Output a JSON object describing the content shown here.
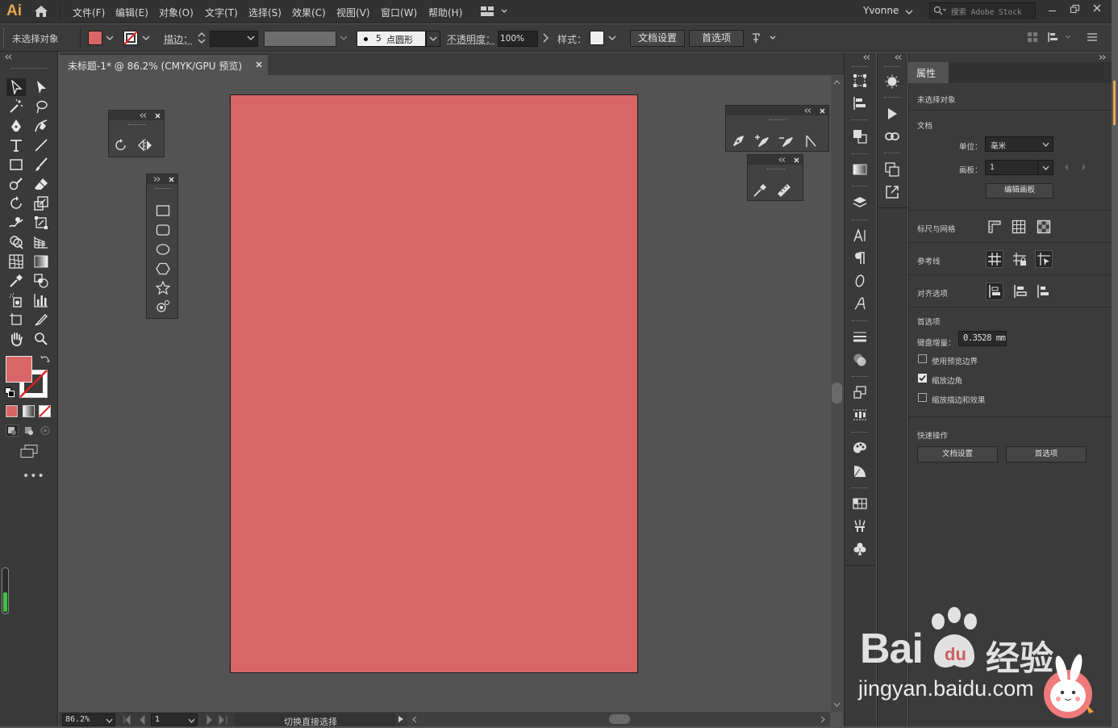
{
  "menubar": {
    "logo": "Ai",
    "items": [
      "文件(F)",
      "编辑(E)",
      "对象(O)",
      "文字(T)",
      "选择(S)",
      "效果(C)",
      "视图(V)",
      "窗口(W)",
      "帮助(H)"
    ],
    "user": "Yvonne",
    "search_placeholder": "搜索 Adobe Stock"
  },
  "controlbar": {
    "selection_status": "未选择对象",
    "stroke_label": "描边：",
    "brush_value": "5",
    "brush_label": "点圆形",
    "opacity_label": "不透明度：",
    "opacity_value": "100%",
    "style_label": "样式：",
    "doc_setup_button": "文档设置",
    "prefs_button": "首选项"
  },
  "document": {
    "tab_title": "未标题-1* @ 86.2% (CMYK/GPU 预览)",
    "artboard_color": "#d96666"
  },
  "status": {
    "zoom": "86.2%",
    "artboard_index": "1",
    "message": "切换直接选择"
  },
  "properties": {
    "tab": "属性",
    "no_selection": "未选择对象",
    "document_section": "文档",
    "units_label": "单位：",
    "units_value": "毫米",
    "artboard_label": "画板：",
    "artboard_value": "1",
    "edit_artboards_button": "编辑画板",
    "rulers_grids_label": "标尺与网格",
    "guides_label": "参考线",
    "align_options_label": "对齐选项",
    "preferences_section": "首选项",
    "keyboard_increment_label": "键盘增量：",
    "keyboard_increment_value": "0.3528 mm",
    "use_preview_bounds": "使用预览边界",
    "use_preview_bounds_checked": false,
    "scale_corners": "缩放边角",
    "scale_corners_checked": true,
    "scale_strokes_effects": "缩放描边和效果",
    "scale_strokes_effects_checked": false,
    "quick_actions_section": "快速操作",
    "doc_setup_button": "文档设置",
    "prefs_button": "首选项"
  },
  "watermark": {
    "brand": "Bai",
    "brand_cn": "经验",
    "url": "jingyan.baidu.com"
  },
  "colors": {
    "fill": "#d96666",
    "accent": "#e8a452"
  }
}
